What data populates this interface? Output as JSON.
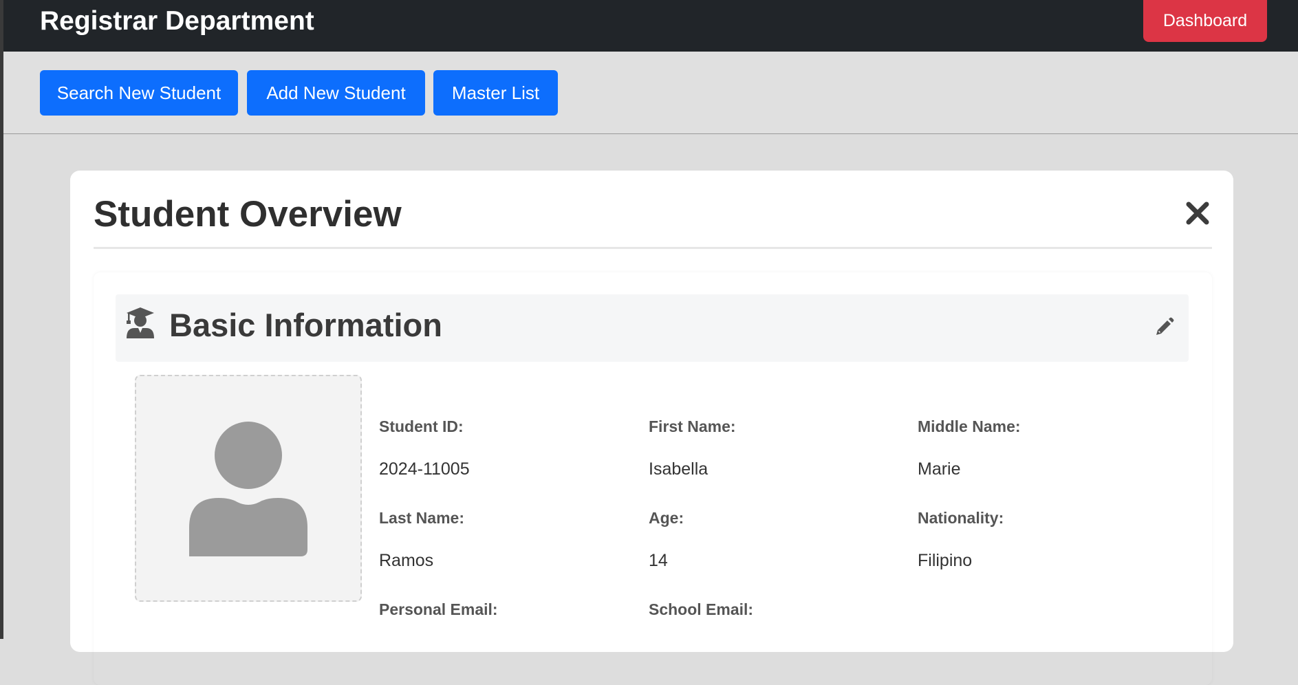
{
  "navbar": {
    "brand": "Registrar Department",
    "dashboard_label": "Dashboard"
  },
  "toolbar": {
    "search_label": "Search New Student",
    "add_label": "Add New Student",
    "master_label": "Master List"
  },
  "overview": {
    "title": "Student Overview",
    "close_icon": "close-icon"
  },
  "basic_info": {
    "title": "Basic Information",
    "section_icon": "graduate-icon",
    "edit_icon": "pencil-icon",
    "photo_icon": "user-placeholder-icon",
    "fields": {
      "student_id": {
        "label": "Student ID:",
        "value": "2024-11005"
      },
      "first_name": {
        "label": "First Name:",
        "value": "Isabella"
      },
      "middle_name": {
        "label": "Middle Name:",
        "value": "Marie"
      },
      "last_name": {
        "label": "Last Name:",
        "value": "Ramos"
      },
      "age": {
        "label": "Age:",
        "value": "14"
      },
      "nationality": {
        "label": "Nationality:",
        "value": "Filipino"
      },
      "personal_email": {
        "label": "Personal Email:"
      },
      "school_email": {
        "label": "School Email:"
      }
    }
  },
  "colors": {
    "navbar": "#212529",
    "primary": "#0d6efd",
    "danger": "#dc3545",
    "page_bg": "#dddddd"
  }
}
